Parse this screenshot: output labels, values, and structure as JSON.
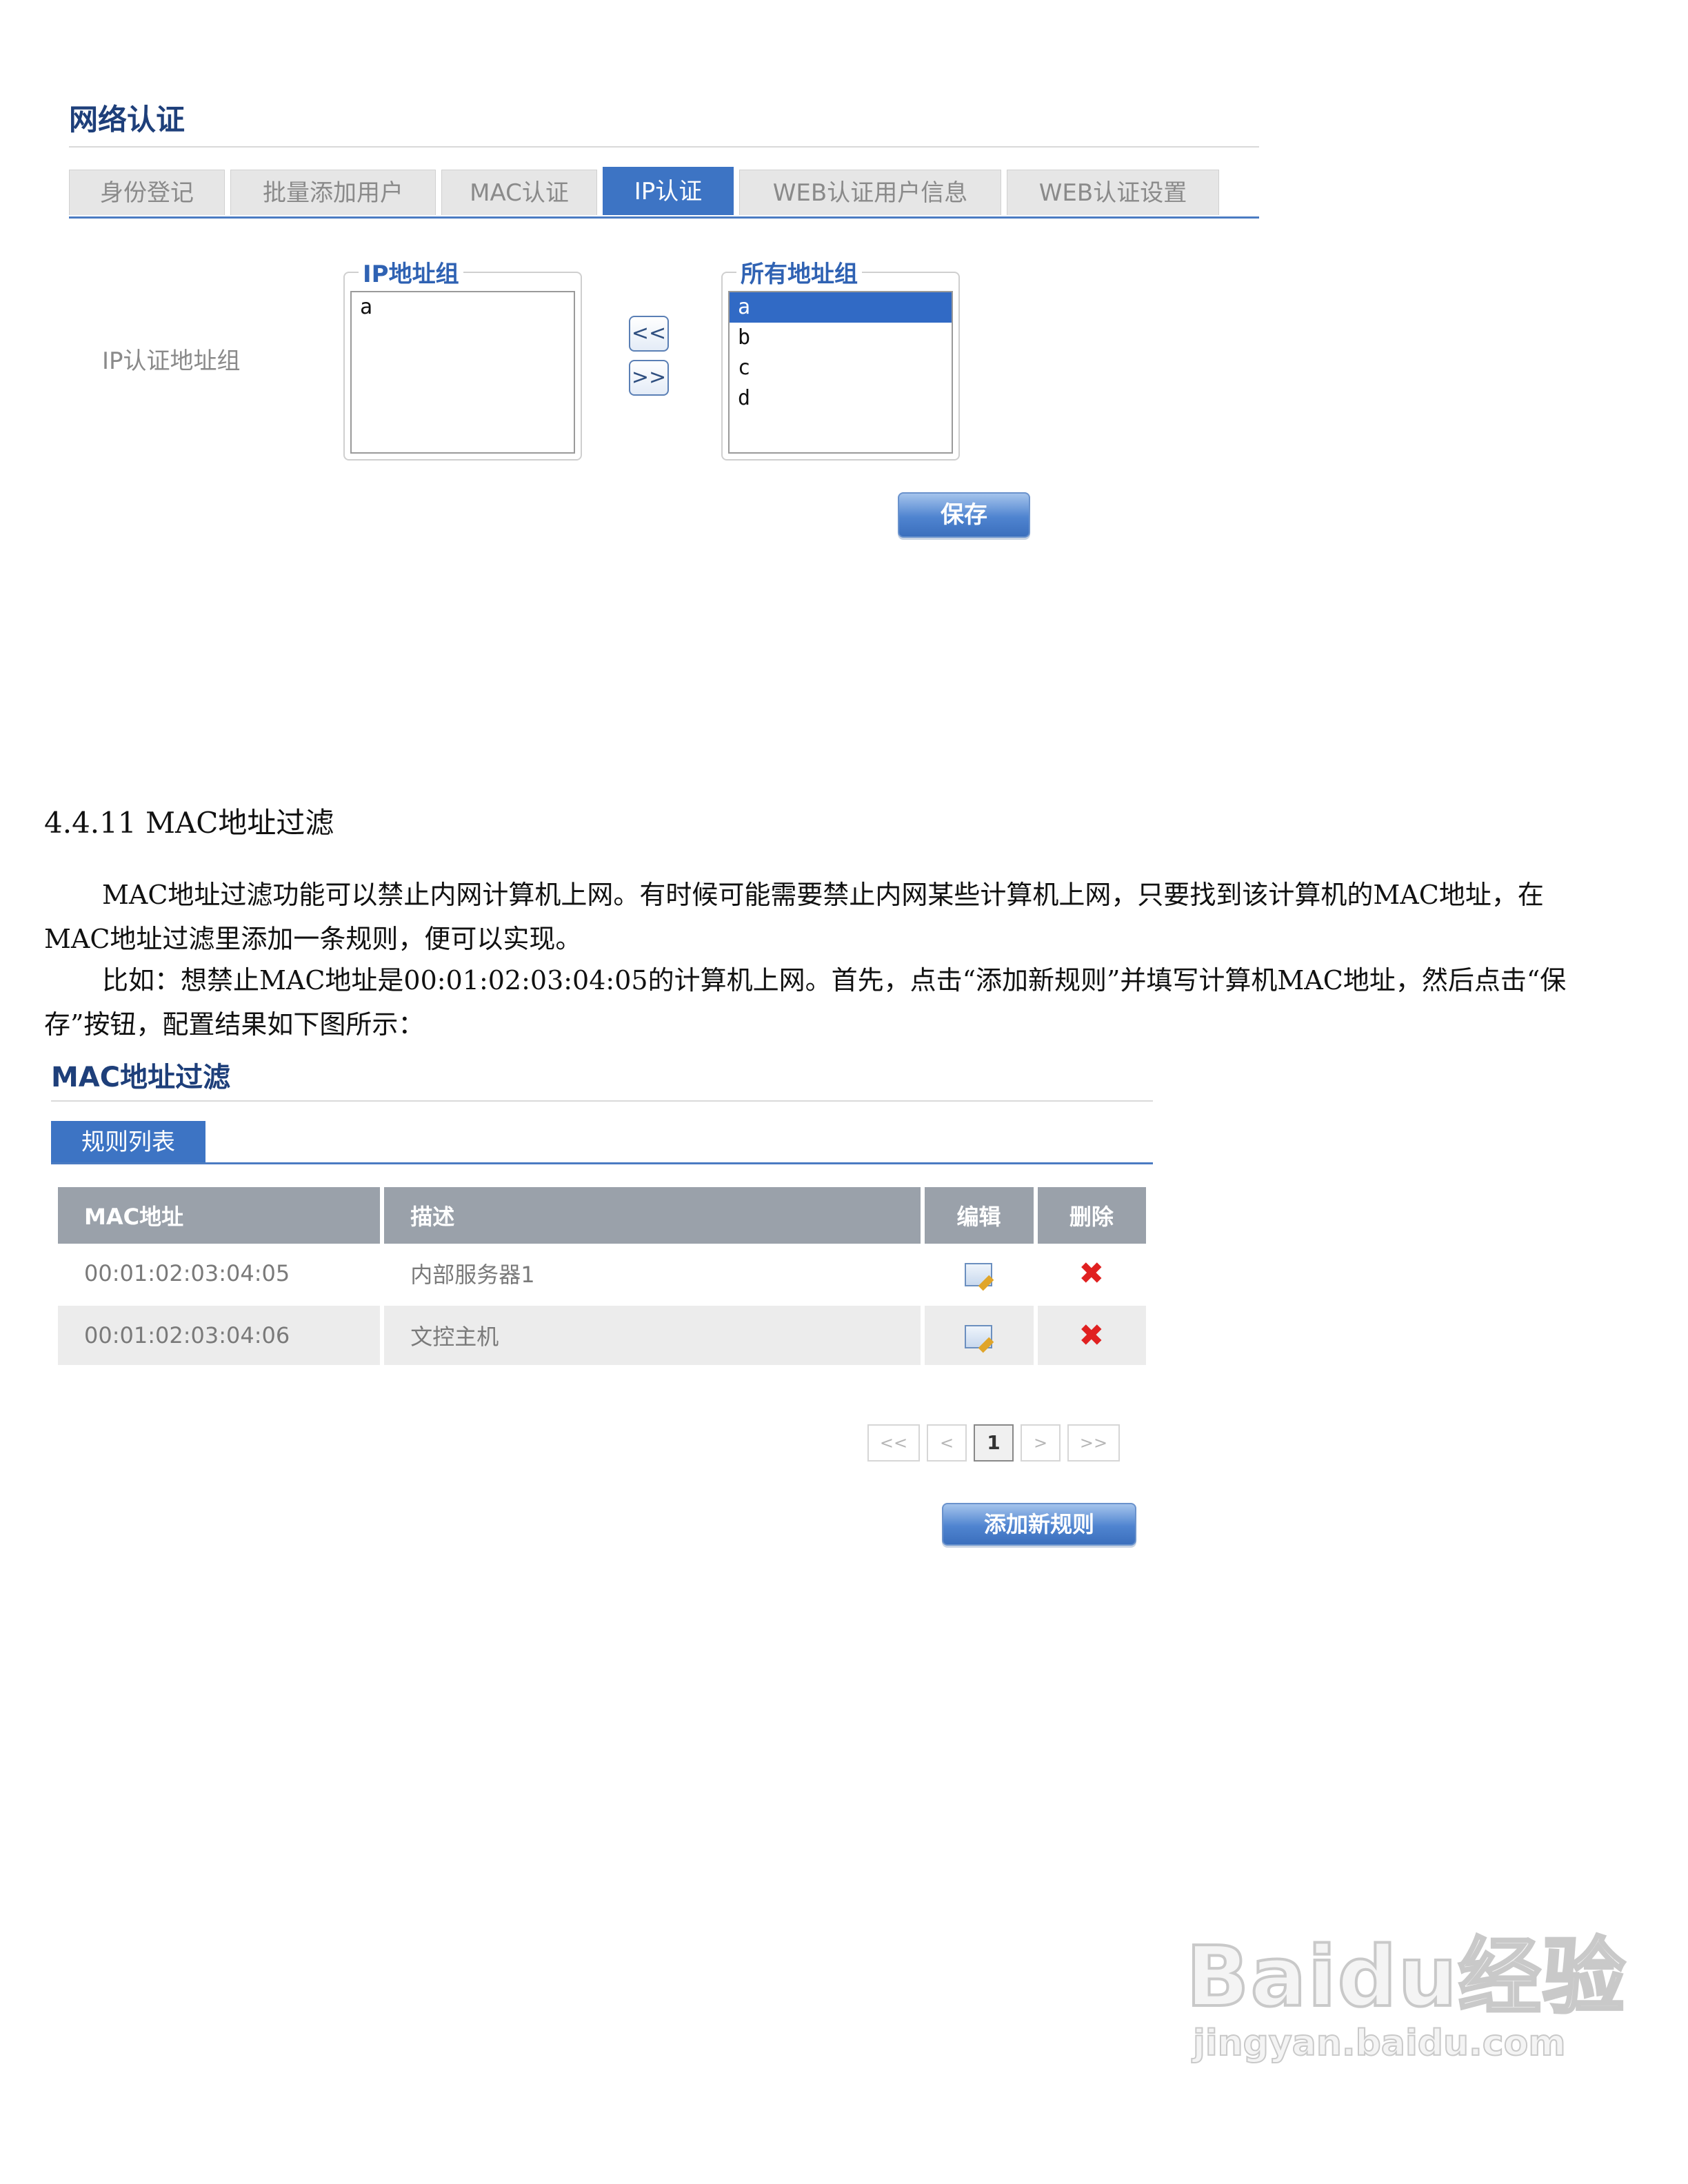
{
  "network_auth": {
    "title": "网络认证",
    "tabs": [
      "身份登记",
      "批量添加用户",
      "MAC认证",
      "IP认证",
      "WEB认证用户信息",
      "WEB认证设置"
    ],
    "active_tab": "IP认证",
    "row_label": "IP认证地址组",
    "left_group": {
      "legend": "IP地址组",
      "items": [
        "a"
      ]
    },
    "right_group": {
      "legend": "所有地址组",
      "items": [
        "a",
        "b",
        "c",
        "d"
      ],
      "selected": "a"
    },
    "move_left_label": "<<",
    "move_right_label": ">>",
    "save_label": "保存"
  },
  "section": {
    "heading": "4.4.11 MAC地址过滤",
    "paragraph1": "MAC地址过滤功能可以禁止内网计算机上网。有时候可能需要禁止内网某些计算机上网，只要找到该计算机的MAC地址，在MAC地址过滤里添加一条规则，便可以实现。",
    "paragraph2": "比如：想禁止MAC地址是00:01:02:03:04:05的计算机上网。首先，点击“添加新规则”并填写计算机MAC地址，然后点击“保存”按钮，配置结果如下图所示："
  },
  "mac_filter": {
    "title": "MAC地址过滤",
    "tab": "规则列表",
    "columns": [
      "MAC地址",
      "描述",
      "编辑",
      "删除"
    ],
    "rows": [
      {
        "mac": "00:01:02:03:04:05",
        "desc": "内部服务器1"
      },
      {
        "mac": "00:01:02:03:04:06",
        "desc": "文控主机"
      }
    ],
    "pager": {
      "first": "<<",
      "prev": "<",
      "current": "1",
      "next": ">",
      "last": ">>"
    },
    "add_label": "添加新规则"
  },
  "watermark": {
    "brand": "Baidu经验",
    "url": "jingyan.baidu.com"
  }
}
